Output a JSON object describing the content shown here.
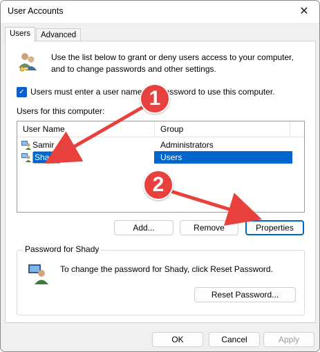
{
  "window": {
    "title": "User Accounts",
    "close_glyph": "✕"
  },
  "tabs": [
    {
      "label": "Users",
      "active": true
    },
    {
      "label": "Advanced",
      "active": false
    }
  ],
  "intro": {
    "text": "Use the list below to grant or deny users access to your computer, and to change passwords and other settings."
  },
  "require_login": {
    "label": "Users must enter a user name and password to use this computer.",
    "checked": true
  },
  "users_section": {
    "label": "Users for this computer:"
  },
  "table": {
    "columns": [
      "User Name",
      "Group"
    ],
    "rows": [
      {
        "name": "Samir",
        "group": "Administrators",
        "selected": false
      },
      {
        "name": "Shady",
        "group": "Users",
        "selected": true
      }
    ]
  },
  "user_buttons": {
    "add": "Add...",
    "remove": "Remove",
    "properties": "Properties"
  },
  "password_group": {
    "label": "Password for Shady",
    "text": "To change the password for Shady, click Reset Password.",
    "reset_button": "Reset Password..."
  },
  "dialog_buttons": {
    "ok": "OK",
    "cancel": "Cancel",
    "apply": "Apply"
  },
  "annotations": {
    "marker_1": "1",
    "marker_2": "2",
    "color": "#e8403c"
  },
  "icons": {
    "users": "users-icon",
    "user": "user-icon",
    "password": "password-user-icon"
  }
}
